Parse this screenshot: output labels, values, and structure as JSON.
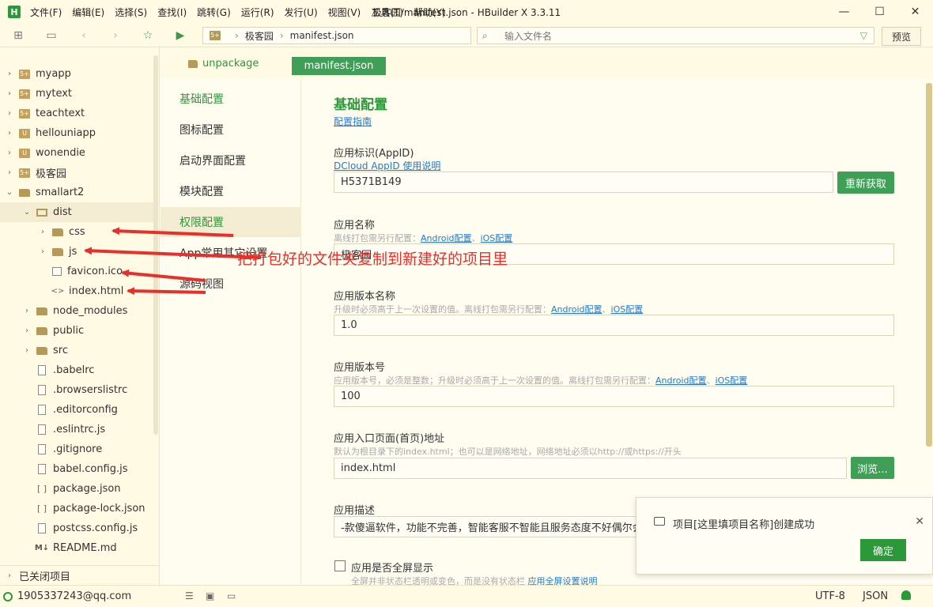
{
  "window": {
    "title": "极客园/manifest.json - HBuilder X 3.3.11",
    "logo": "H",
    "minimize": "—",
    "maximize": "☐",
    "close": "✕"
  },
  "menu": [
    "文件(F)",
    "编辑(E)",
    "选择(S)",
    "查找(I)",
    "跳转(G)",
    "运行(R)",
    "发行(U)",
    "视图(V)",
    "工具(T)",
    "帮助(Y)"
  ],
  "toolbar": {
    "breadcrumb_project": "极客园",
    "breadcrumb_file": "manifest.json",
    "search_placeholder": "输入文件名",
    "preview_label": "预览"
  },
  "sidebar": {
    "items": [
      {
        "label": "myapp",
        "icon": "project-icon"
      },
      {
        "label": "mytext",
        "icon": "project-icon"
      },
      {
        "label": "teachtext",
        "icon": "project-icon"
      },
      {
        "label": "hellouniapp",
        "icon": "uni-project-icon"
      },
      {
        "label": "wonendie",
        "icon": "uni-project-icon"
      },
      {
        "label": "极客园",
        "icon": "project-icon"
      },
      {
        "label": "smallart2",
        "icon": "folder-icon"
      },
      {
        "label": "dist",
        "icon": "folder-open-icon"
      },
      {
        "label": "css",
        "icon": "folder-icon"
      },
      {
        "label": "js",
        "icon": "folder-icon"
      },
      {
        "label": "favicon.ico",
        "icon": "image-file-icon"
      },
      {
        "label": "index.html",
        "icon": "html-file-icon"
      },
      {
        "label": "node_modules",
        "icon": "folder-icon"
      },
      {
        "label": "public",
        "icon": "folder-icon"
      },
      {
        "label": "src",
        "icon": "folder-icon"
      },
      {
        "label": ".babelrc",
        "icon": "file-icon"
      },
      {
        "label": ".browserslistrc",
        "icon": "file-icon"
      },
      {
        "label": ".editorconfig",
        "icon": "file-icon"
      },
      {
        "label": ".eslintrc.js",
        "icon": "js-file-icon"
      },
      {
        "label": ".gitignore",
        "icon": "file-icon"
      },
      {
        "label": "babel.config.js",
        "icon": "js-file-icon"
      },
      {
        "label": "package.json",
        "icon": "json-file-icon"
      },
      {
        "label": "package-lock.json",
        "icon": "json-file-icon"
      },
      {
        "label": "postcss.config.js",
        "icon": "js-file-icon"
      },
      {
        "label": "README.md",
        "icon": "markdown-file-icon"
      }
    ],
    "closed_projects": "已关闭项目"
  },
  "tabs": {
    "unpackage": "unpackage",
    "manifest": "manifest.json"
  },
  "config_nav": [
    "基础配置",
    "图标配置",
    "启动界面配置",
    "模块配置",
    "权限配置",
    "App常用其它设置",
    "源码视图"
  ],
  "form": {
    "title": "基础配置",
    "guide_link": "配置指南",
    "appid_label": "应用标识(AppID)",
    "appid_link": "DCloud AppID 使用说明",
    "appid_value": "H5371B149",
    "appid_button": "重新获取",
    "name_label": "应用名称",
    "name_hint": "离线打包需另行配置：",
    "name_value": "极客园",
    "version_name_label": "应用版本名称",
    "version_name_hint": "升级时必须高于上一次设置的值。离线打包需另行配置：",
    "version_name_value": "1.0",
    "version_code_label": "应用版本号",
    "version_code_hint": "应用版本号，必须是整数；升级时必须高于上一次设置的值。离线打包需另行配置：",
    "version_code_value": "100",
    "entry_label": "应用入口页面(首页)地址",
    "entry_hint": "默认为根目录下的index.html；也可以是网络地址，网络地址必须以http://或https://开头",
    "entry_value": "index.html",
    "entry_button": "浏览...",
    "desc_label": "应用描述",
    "desc_value": "-款傻逼软件，功能不完善，智能客服不智能且服务态度不好偶尔会宕机，请不要在极客园里购买任何东西，软件傻逼使用。",
    "fullscreen_label": "应用是否全屏显示",
    "fullscreen_hint": "全屏并非状态栏透明或变色，而是没有状态栏",
    "fullscreen_link": "应用全屏设置说明",
    "android_link": "Android配置",
    "ios_link": "iOS配置",
    "link_sep": "、"
  },
  "toast": {
    "message": "项目[这里填项目名称]创建成功",
    "ok_label": "确定",
    "close": "✕"
  },
  "status": {
    "user": "1905337243@qq.com",
    "encoding": "UTF-8",
    "language": "JSON"
  },
  "annotation": {
    "text": "把打包好的文件夹复制到新建好的项目里",
    "color": "#e8302a"
  }
}
